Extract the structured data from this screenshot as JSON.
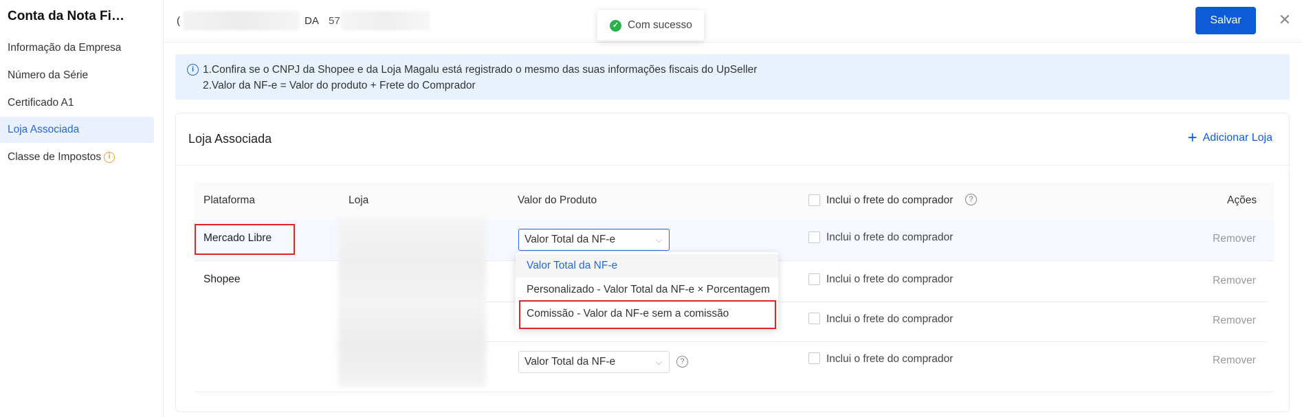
{
  "sidebar": {
    "title": "Conta da Nota Fi…",
    "items": [
      {
        "label": "Informação da Empresa"
      },
      {
        "label": "Número da Série"
      },
      {
        "label": "Certificado A1"
      },
      {
        "label": "Loja Associada"
      },
      {
        "label": "Classe de Impostos"
      }
    ],
    "active_index": 3
  },
  "header": {
    "prefix": "(",
    "mid": "DA",
    "num": "57",
    "save_label": "Salvar",
    "close_label": "✕"
  },
  "toast": {
    "message": "Com sucesso",
    "icon": "check-circle-icon"
  },
  "notice": {
    "line1": "1.Confira se o CNPJ da Shopee e da Loja Magalu está registrado o mesmo das suas informações fiscais do UpSeller",
    "line2": "2.Valor da NF-e = Valor do produto + Frete do Comprador"
  },
  "card": {
    "title": "Loja Associada",
    "add_label": "Adicionar Loja"
  },
  "table": {
    "headers": {
      "plataforma": "Plataforma",
      "loja": "Loja",
      "valor": "Valor do Produto",
      "frete": "Inclui o frete do comprador",
      "acoes": "Ações"
    },
    "rows": [
      {
        "plataforma": "Mercado Libre",
        "valor": "Valor Total da NF-e",
        "frete": "Inclui o frete do comprador",
        "acao": "Remover"
      },
      {
        "plataforma": "Shopee",
        "frete": "Inclui o frete do comprador",
        "acao": "Remover"
      },
      {
        "frete": "Inclui o frete do comprador",
        "acao": "Remover"
      },
      {
        "valor": "Valor Total da NF-e",
        "frete": "Inclui o frete do comprador",
        "acao": "Remover"
      }
    ]
  },
  "dropdown": {
    "options": [
      {
        "label": "Valor Total da NF-e"
      },
      {
        "label": "Personalizado - Valor Total da NF-e × Porcentagem"
      },
      {
        "label": "Comissão - Valor da NF-e sem a comissão"
      }
    ],
    "selected_index": 0
  },
  "colors": {
    "accent": "#0d5bd6",
    "highlight_red": "#e02424",
    "success": "#2bb14c"
  }
}
